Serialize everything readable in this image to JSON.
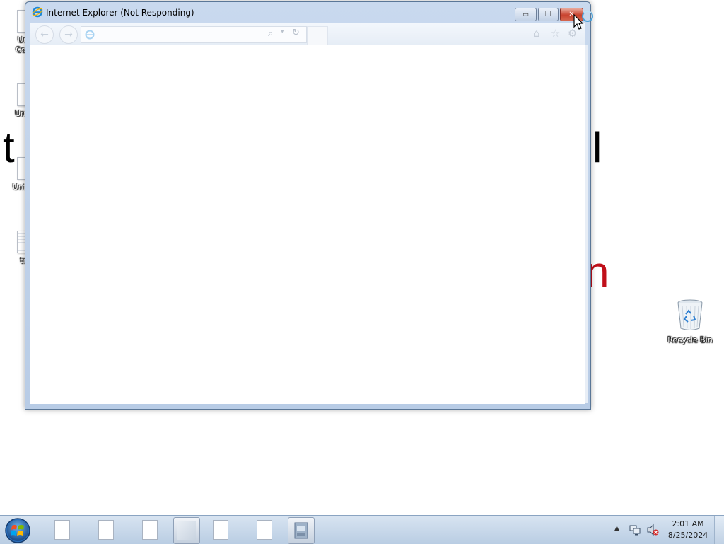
{
  "desktop": {
    "background_text": {
      "left_glyph": "t",
      "right_glyph": "l",
      "red_glyph": "n"
    },
    "icons": [
      {
        "label_line1": "Unti",
        "label_line2": "Copy"
      },
      {
        "label_line1": "Untitl"
      },
      {
        "label_line1": "Untitle"
      },
      {
        "label_line1": "tre"
      }
    ],
    "recycle_bin": {
      "label": "Recycle Bin"
    }
  },
  "window": {
    "title": "Internet Explorer (Not Responding)",
    "caption": {
      "minimize": "▭",
      "maximize": "❐",
      "close": "✕"
    },
    "toolbar": {
      "back": "←",
      "forward": "→",
      "address_value": "",
      "search_glyph": "⌕",
      "dropdown_glyph": "▾",
      "refresh_glyph": "↻",
      "home": "⌂",
      "favorites": "☆",
      "tools": "⚙"
    }
  },
  "taskbar": {
    "items": [
      {
        "name": "document-1",
        "active": false
      },
      {
        "name": "document-2",
        "active": false
      },
      {
        "name": "document-3",
        "active": false
      },
      {
        "name": "blank-window",
        "active": true
      },
      {
        "name": "document-4",
        "active": false
      },
      {
        "name": "document-5",
        "active": false
      },
      {
        "name": "computer-window",
        "active": true
      }
    ],
    "tray": {
      "expand": "▲"
    },
    "clock": {
      "time": "2:01 AM",
      "date": "8/25/2024"
    }
  },
  "colors": {
    "window_frame": "#c9d9ee",
    "close_red": "#c8432f",
    "taskbar": "#c7d7ea",
    "bg_red_text": "#c0101a"
  }
}
